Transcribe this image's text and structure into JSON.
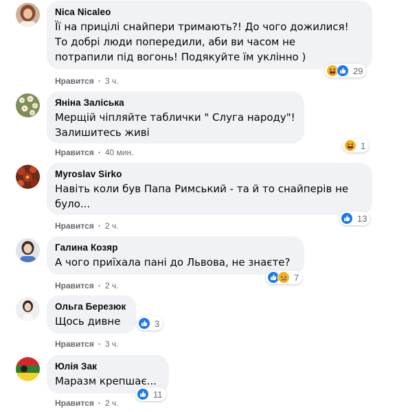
{
  "comments": [
    {
      "author": "Nica Nicaleo",
      "lines": [
        "Її на прицілі снайпери тримають?! До чого дожилися!",
        "То добрі люди попередили, аби ви часом не",
        "потрапили під вогонь! Подякуйте їм уклінно )"
      ],
      "like_label": "Нравится",
      "time": "3 ч.",
      "reaction_icons": [
        "haha-icon",
        "like-icon"
      ],
      "reaction_count": "29"
    },
    {
      "author": "Яніна Заліська",
      "lines": [
        "Мерщій чіпляйте таблички \" Слуга народу\"!",
        "Залишитесь живі"
      ],
      "like_label": "Нравится",
      "time": "40 мин.",
      "reaction_icons": [
        "haha-icon"
      ],
      "reaction_count": "1"
    },
    {
      "author": "Myroslav Sirko",
      "lines": [
        "Навіть коли був Папа Римський - та й то снайперів не",
        "було..."
      ],
      "like_label": "Нравится",
      "time": "2 ч.",
      "reaction_icons": [
        "like-icon"
      ],
      "reaction_count": "13"
    },
    {
      "author": "Галина Козяр",
      "lines": [
        "А чого приїхала пані до Львова, не знаєте?"
      ],
      "like_label": "Нравится",
      "time": "2 ч.",
      "reaction_icons": [
        "like-icon",
        "sad-icon"
      ],
      "reaction_count": "7"
    },
    {
      "author": "Ольга Березюк",
      "lines": [
        "Щось дивне"
      ],
      "like_label": "Нравится",
      "time": "3 ч.",
      "reaction_icons": [
        "like-icon"
      ],
      "reaction_count": "3"
    },
    {
      "author": "Юлія Зак",
      "lines": [
        "Маразм крепшає..."
      ],
      "like_label": "Нравится",
      "time": "2 ч.",
      "reaction_icons": [
        "like-icon"
      ],
      "reaction_count": "11"
    }
  ],
  "colors": {
    "bubble": "#f0f2f5",
    "meta_text": "#65676b",
    "like_blue": "#1877f2",
    "haha_yellow": "#f7b125",
    "sad_yellow": "#f7b125"
  }
}
